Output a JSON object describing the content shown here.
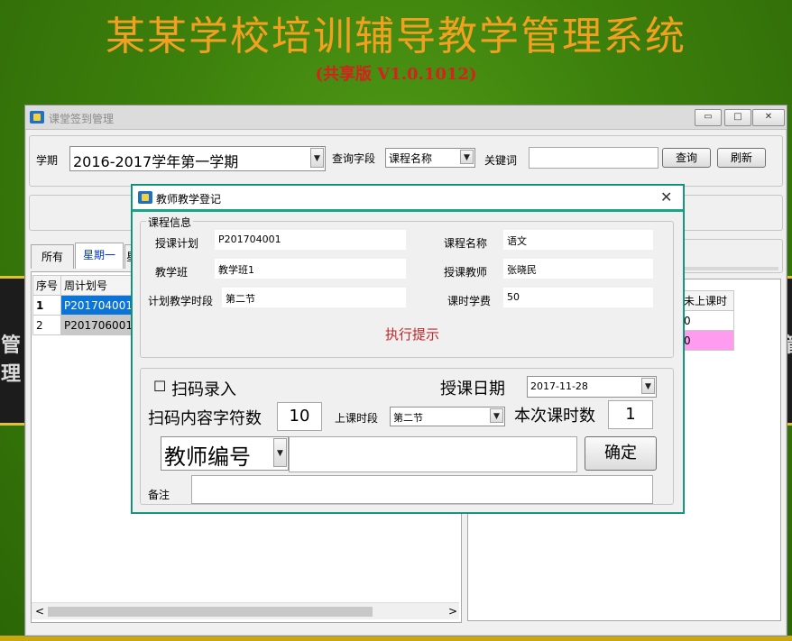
{
  "banner": {
    "title": "某某学校培训辅导教学管理系统",
    "subtitle": "(共享版 V1.0.1012)",
    "bg_left_text": "管理",
    "bg_right_text": "管"
  },
  "main_window": {
    "title": "课堂签到管理",
    "minimize": "▭",
    "maximize": "□",
    "close": "✕",
    "semester_label": "学期",
    "semester_value": "2016-2017学年第一学期",
    "query_field_label": "查询字段",
    "query_field_value": "课程名称",
    "keyword_label": "关键词",
    "keyword_value": "",
    "query_button": "查询",
    "refresh_button": "刷新",
    "tabs": [
      "所有",
      "星期一",
      "星"
    ],
    "left_table": {
      "headers": [
        "序号",
        "周计划号"
      ],
      "rows": [
        [
          "1",
          "P2017040010"
        ],
        [
          "2",
          "P2017060010"
        ]
      ]
    },
    "right_table": {
      "headers": [
        "时",
        "未上课时"
      ],
      "rows": [
        [
          "",
          "0"
        ],
        [
          "",
          "0"
        ]
      ]
    },
    "scroll_left": "<",
    "scroll_right": ">"
  },
  "dialog": {
    "title": "教师教学登记",
    "close": "✕",
    "course_info": {
      "legend": "课程信息",
      "plan_label": "授课计划",
      "plan_value": "P201704001",
      "course_name_label": "课程名称",
      "course_name_value": "语文",
      "class_label": "教学班",
      "class_value": "教学班1",
      "teacher_label": "授课教师",
      "teacher_value": "张晓民",
      "period_label": "计划教学时段",
      "period_value": "第二节",
      "fee_label": "课时学费",
      "fee_value": "50"
    },
    "hint": "执行提示",
    "scan_checkbox_glyph": "☐",
    "scan_label": "扫码录入",
    "date_label": "授课日期",
    "date_value": "2017-11-28",
    "scan_len_label": "扫码内容字符数",
    "scan_len_value": "10",
    "class_period_label": "上课时段",
    "class_period_value": "第二节",
    "hours_label": "本次课时数",
    "hours_value": "1",
    "id_type_value": "教师编号",
    "id_input_value": "",
    "confirm_button": "确定",
    "remark_label": "备注",
    "remark_value": ""
  },
  "colors": {
    "title_orange": "#f3a020",
    "subtitle_red": "#d8201c",
    "dialog_accent": "#16a085",
    "selected_row": "#0a74d8",
    "pink_row": "#ff9cf0",
    "hint_red": "#c0282a"
  }
}
